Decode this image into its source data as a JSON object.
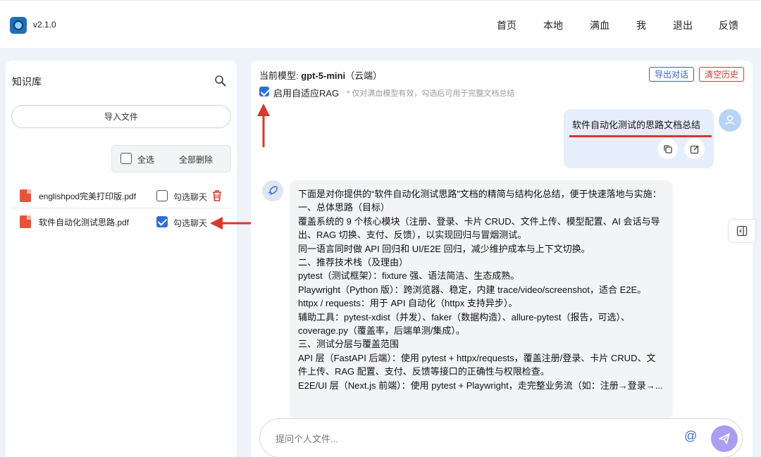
{
  "header": {
    "version": "v2.1.0",
    "nav": [
      "首页",
      "本地",
      "满血",
      "我",
      "退出",
      "反馈"
    ]
  },
  "sidebar": {
    "title": "知识库",
    "import_label": "导入文件",
    "select_all_label": "全选",
    "delete_all_label": "全部删除",
    "files": [
      {
        "name": "englishpod完美打印版.pdf",
        "chat_label": "勾选聊天",
        "checked": false
      },
      {
        "name": "软件自动化测试思路.pdf",
        "chat_label": "勾选聊天",
        "checked": true
      }
    ]
  },
  "chat": {
    "model_prefix": "当前模型: ",
    "model_name": "gpt-5-mini",
    "model_suffix": "（云端）",
    "export_label": "导出对话",
    "clear_label": "清空历史",
    "rag_label": "启用自适应RAG",
    "rag_hint": "* 仅对满血模型有效，勾选后可用于完整文档总结",
    "rag_checked": true,
    "user_message": "软件自动化测试的思路文档总结",
    "assistant_lines": [
      "下面是对你提供的“软件自动化测试思路”文档的精简与结构化总结，便于快速落地与实施：",
      "一、总体思路（目标）",
      "覆盖系统的 9 个核心模块（注册、登录、卡片 CRUD、文件上传、模型配置、AI 会话与导出、RAG 切换、支付、反馈），以实现回归与冒烟测试。",
      "同一语言同时做 API 回归和 UI/E2E 回归，减少维护成本与上下文切换。",
      "二、推荐技术栈（及理由）",
      "pytest（测试框架）：fixture 强、语法简洁、生态成熟。",
      "Playwright（Python 版）：跨浏览器、稳定，内建 trace/video/screenshot，适合 E2E。",
      "httpx / requests：用于 API 自动化（httpx 支持异步）。",
      "辅助工具：pytest-xdist（并发）、faker（数据构造）、allure-pytest（报告，可选）、coverage.py（覆盖率，后端单测/集成）。",
      "三、测试分层与覆盖范围",
      "API 层（FastAPI 后端）：使用 pytest + httpx/requests，覆盖注册/登录、卡片 CRUD、文件上传、RAG 配置、支付、反馈等接口的正确性与权限检查。",
      "E2E/UI 层（Next.js 前端）：使用 pytest + Playwright，走完整业务流（如：注册→登录→..."
    ],
    "input_placeholder": "提问个人文件...",
    "at_label": "@"
  },
  "colors": {
    "accent": "#2f6fd6",
    "danger": "#d8382c",
    "send": "#a99ef3",
    "export_border": "#3b5bdb"
  }
}
